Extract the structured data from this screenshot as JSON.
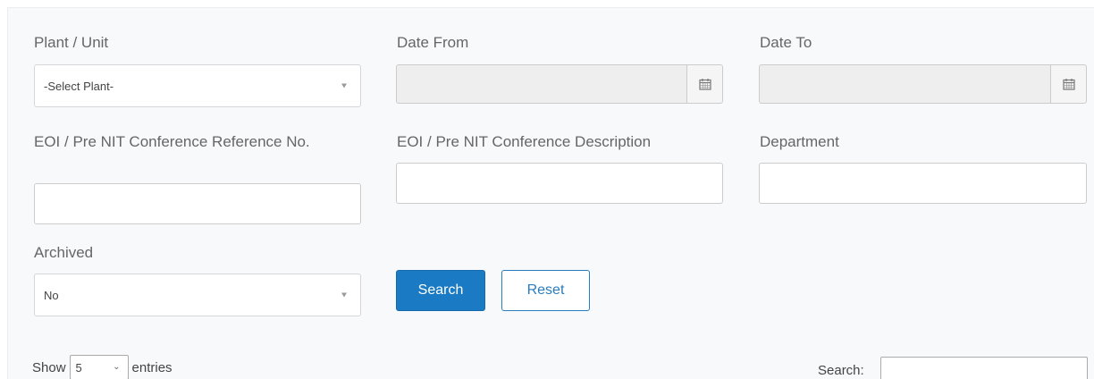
{
  "filters": {
    "plant": {
      "label": "Plant / Unit",
      "selected": "-Select Plant-"
    },
    "date_from": {
      "label": "Date From",
      "value": ""
    },
    "date_to": {
      "label": "Date To",
      "value": ""
    },
    "ref_no": {
      "label": "EOI / Pre NIT Conference Reference No.",
      "value": ""
    },
    "description": {
      "label": "EOI / Pre NIT Conference Description",
      "value": ""
    },
    "department": {
      "label": "Department",
      "value": ""
    },
    "archived": {
      "label": "Archived",
      "selected": "No"
    }
  },
  "buttons": {
    "search": "Search",
    "reset": "Reset"
  },
  "table_controls": {
    "show_prefix": "Show",
    "page_length": "5",
    "show_suffix": "entries",
    "search_label": "Search:"
  },
  "colors": {
    "primary": "#1b7ac4",
    "panel_bg": "#f8f9fa",
    "disabled_bg": "#eeeeee"
  },
  "icons": [
    "calendar-icon",
    "caret-down-icon",
    "chevron-down-icon"
  ]
}
